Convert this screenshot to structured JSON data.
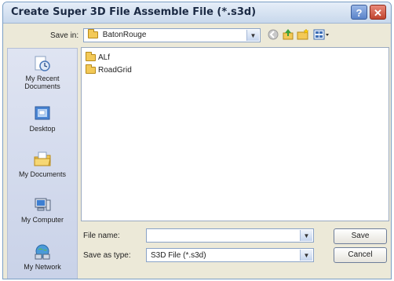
{
  "window": {
    "title": "Create Super 3D File Assemble File (*.s3d)"
  },
  "save_in": {
    "label": "Save in:",
    "value": "BatonRouge"
  },
  "places": [
    {
      "label": "My Recent Documents"
    },
    {
      "label": "Desktop"
    },
    {
      "label": "My Documents"
    },
    {
      "label": "My Computer"
    },
    {
      "label": "My Network"
    }
  ],
  "files": [
    {
      "name": "ALf"
    },
    {
      "name": "RoadGrid"
    }
  ],
  "file_name": {
    "label": "File name:",
    "value": ""
  },
  "save_as_type": {
    "label": "Save as type:",
    "value": "S3D File (*.s3d)"
  },
  "buttons": {
    "save": "Save",
    "cancel": "Cancel"
  }
}
